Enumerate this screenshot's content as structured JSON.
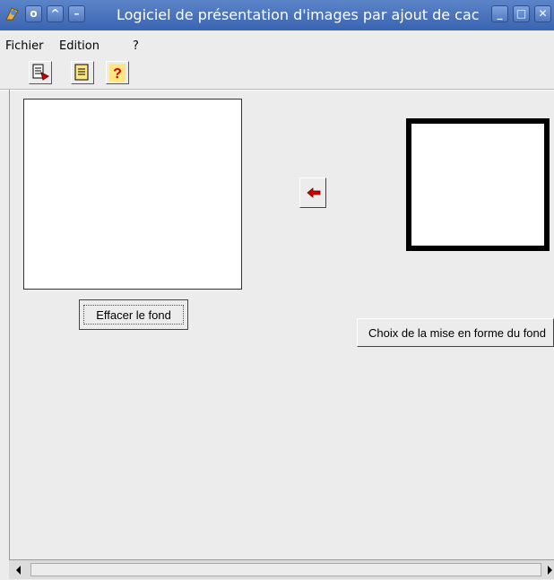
{
  "window": {
    "title": "Logiciel de présentation d'images par ajout de cac",
    "controls": [
      "app-icon",
      "pin-icon",
      "shade-icon",
      "minimize-icon",
      "iconify-icon",
      "maximize-icon",
      "close-icon"
    ]
  },
  "menu": {
    "items": [
      {
        "label": "Fichier"
      },
      {
        "label": "Edition"
      },
      {
        "label": "?"
      }
    ]
  },
  "toolbar": {
    "buttons": [
      {
        "icon": "open-document-icon"
      },
      {
        "icon": "document-icon"
      },
      {
        "icon": "help-question-icon",
        "glyph": "?"
      }
    ]
  },
  "left_panel": {
    "clear_button_label": "Effacer le fond"
  },
  "center": {
    "arrow_icon": "red-left-arrow-icon"
  },
  "right_panel": {
    "choice_button_label": "Choix de la mise en forme du fond"
  },
  "colors": {
    "titlebar": "#3a64b0",
    "background": "#ececec",
    "frame_border": "#000000",
    "arrow": "#cc0000"
  }
}
